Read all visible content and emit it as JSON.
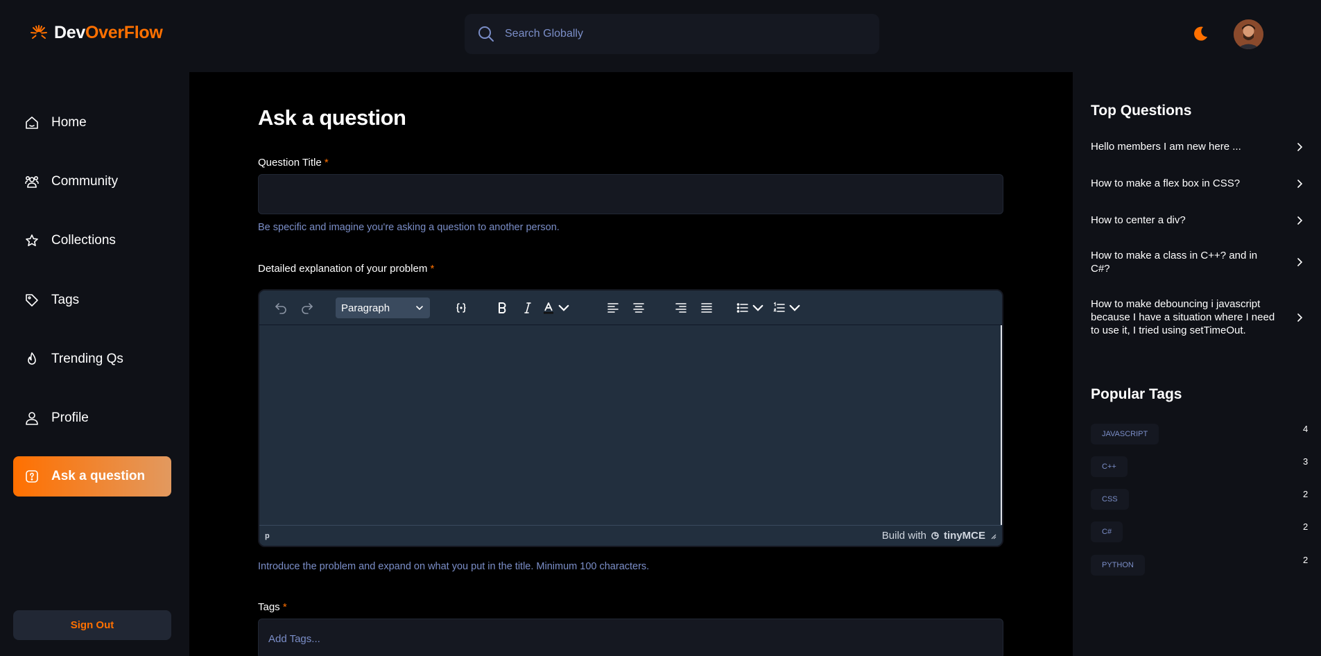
{
  "brand": {
    "name_part1": "Dev",
    "name_part2": "OverFlow"
  },
  "search": {
    "placeholder": "Search Globally"
  },
  "sidebar": {
    "items": [
      {
        "label": "Home",
        "icon": "home-icon"
      },
      {
        "label": "Community",
        "icon": "users-icon"
      },
      {
        "label": "Collections",
        "icon": "star-icon"
      },
      {
        "label": "Tags",
        "icon": "tag-icon"
      },
      {
        "label": "Trending Qs",
        "icon": "flame-icon"
      },
      {
        "label": "Profile",
        "icon": "user-icon"
      },
      {
        "label": "Ask a question",
        "icon": "question-icon",
        "active": true
      }
    ],
    "sign_out": "Sign Out"
  },
  "main": {
    "title": "Ask a question",
    "question_title": {
      "label": "Question Title",
      "required_mark": "*",
      "value": "",
      "hint": "Be specific and imagine you're asking a question to another person."
    },
    "explanation": {
      "label": "Detailed explanation of your problem",
      "required_mark": "*",
      "format_select": "Paragraph",
      "status_path": "p",
      "branding_prefix": "Build with",
      "branding_name": "tinyMCE",
      "hint": "Introduce the problem and expand on what you put in the title. Minimum 100 characters."
    },
    "tags": {
      "label": "Tags",
      "required_mark": "*",
      "placeholder": "Add Tags..."
    }
  },
  "right_sidebar": {
    "top_questions_title": "Top Questions",
    "top_questions": [
      "Hello members I am new here ...",
      "How to make a flex box in CSS?",
      "How to center a div?",
      "How to make a class in C++? and in C#?",
      "How to make debouncing i javascript because I have a situation where I need to use it, I tried using setTimeOut."
    ],
    "popular_tags_title": "Popular Tags",
    "popular_tags": [
      {
        "name": "javascript",
        "count": "4"
      },
      {
        "name": "c++",
        "count": "3"
      },
      {
        "name": "css",
        "count": "2"
      },
      {
        "name": "c#",
        "count": "2"
      },
      {
        "name": "python",
        "count": "2"
      }
    ]
  },
  "colors": {
    "accent": "#ff7000",
    "accent_gradient_end": "#e2995f",
    "hint_blue": "#7b8ec8",
    "panel": "#0f1117",
    "input_bg": "#151821",
    "editor_bg": "#222f3e"
  }
}
